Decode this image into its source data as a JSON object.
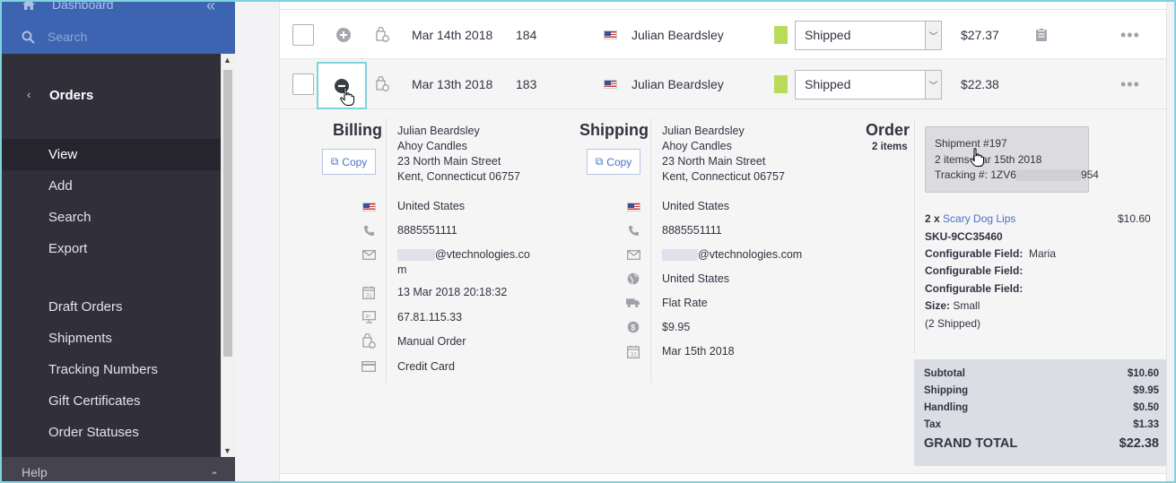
{
  "sidebar": {
    "dashboard_label": "Dashboard",
    "search_placeholder": "Search",
    "section_title": "Orders",
    "items": [
      {
        "label": "View",
        "active": true
      },
      {
        "label": "Add"
      },
      {
        "label": "Search"
      },
      {
        "label": "Export"
      },
      {
        "label": "Draft Orders"
      },
      {
        "label": "Shipments"
      },
      {
        "label": "Tracking Numbers"
      },
      {
        "label": "Gift Certificates"
      },
      {
        "label": "Order Statuses"
      }
    ],
    "help_label": "Help"
  },
  "orders": [
    {
      "date": "Mar 14th 2018",
      "id": "184",
      "customer": "Julian Beardsley",
      "status": "Shipped",
      "total": "$27.37",
      "status_color": "#b8dc5a"
    },
    {
      "date": "Mar 13th 2018",
      "id": "183",
      "customer": "Julian Beardsley",
      "status": "Shipped",
      "total": "$22.38",
      "status_color": "#b8dc5a"
    }
  ],
  "detail": {
    "billing": {
      "title": "Billing",
      "copy_label": "Copy",
      "name": "Julian Beardsley",
      "company": "Ahoy Candles",
      "street": "23 North Main Street",
      "city": "Kent, Connecticut 06757",
      "country": "United States",
      "phone": "8885551111",
      "email_line1": "@vtechnologies.co",
      "email_line2": "m",
      "date": "13 Mar 2018 20:18:32",
      "ip": "67.81.115.33",
      "source": "Manual Order",
      "payment": "Credit Card"
    },
    "shipping": {
      "title": "Shipping",
      "copy_label": "Copy",
      "name": "Julian Beardsley",
      "company": "Ahoy Candles",
      "street": "23 North Main Street",
      "city": "Kent, Connecticut 06757",
      "country": "United States",
      "phone": "8885551111",
      "email": "@vtechnologies.com",
      "region": "United States",
      "method": "Flat Rate",
      "cost": "$9.95",
      "ship_date": "Mar 15th 2018"
    },
    "order": {
      "title": "Order",
      "count": "2 items",
      "shipment_link": "Shipment #197",
      "shipment_items": "2 items",
      "shipment_date": "Mar 15th 2018",
      "tracking_label": "Tracking #: 1ZV6",
      "tracking_suffix": "954",
      "item_qty": "2 x",
      "item_name": "Scary Dog Lips",
      "item_price": "$10.60",
      "sku": "SKU-9CC35460",
      "field_label": "Configurable Field:",
      "field1_value": "Maria",
      "size_label": "Size:",
      "size_value": "Small",
      "shipped_note": "(2 Shipped)",
      "totals": [
        {
          "label": "Subtotal",
          "value": "$10.60"
        },
        {
          "label": "Shipping",
          "value": "$9.95"
        },
        {
          "label": "Handling",
          "value": "$0.50"
        },
        {
          "label": "Tax",
          "value": "$1.33"
        }
      ],
      "grand_total_label": "GRAND TOTAL",
      "grand_total_value": "$22.38"
    }
  },
  "colors": {
    "sidebar_top": "#3c64b1",
    "sidebar": "#302f3a",
    "link": "#4b71c9",
    "status_shipped": "#b8dc5a"
  }
}
